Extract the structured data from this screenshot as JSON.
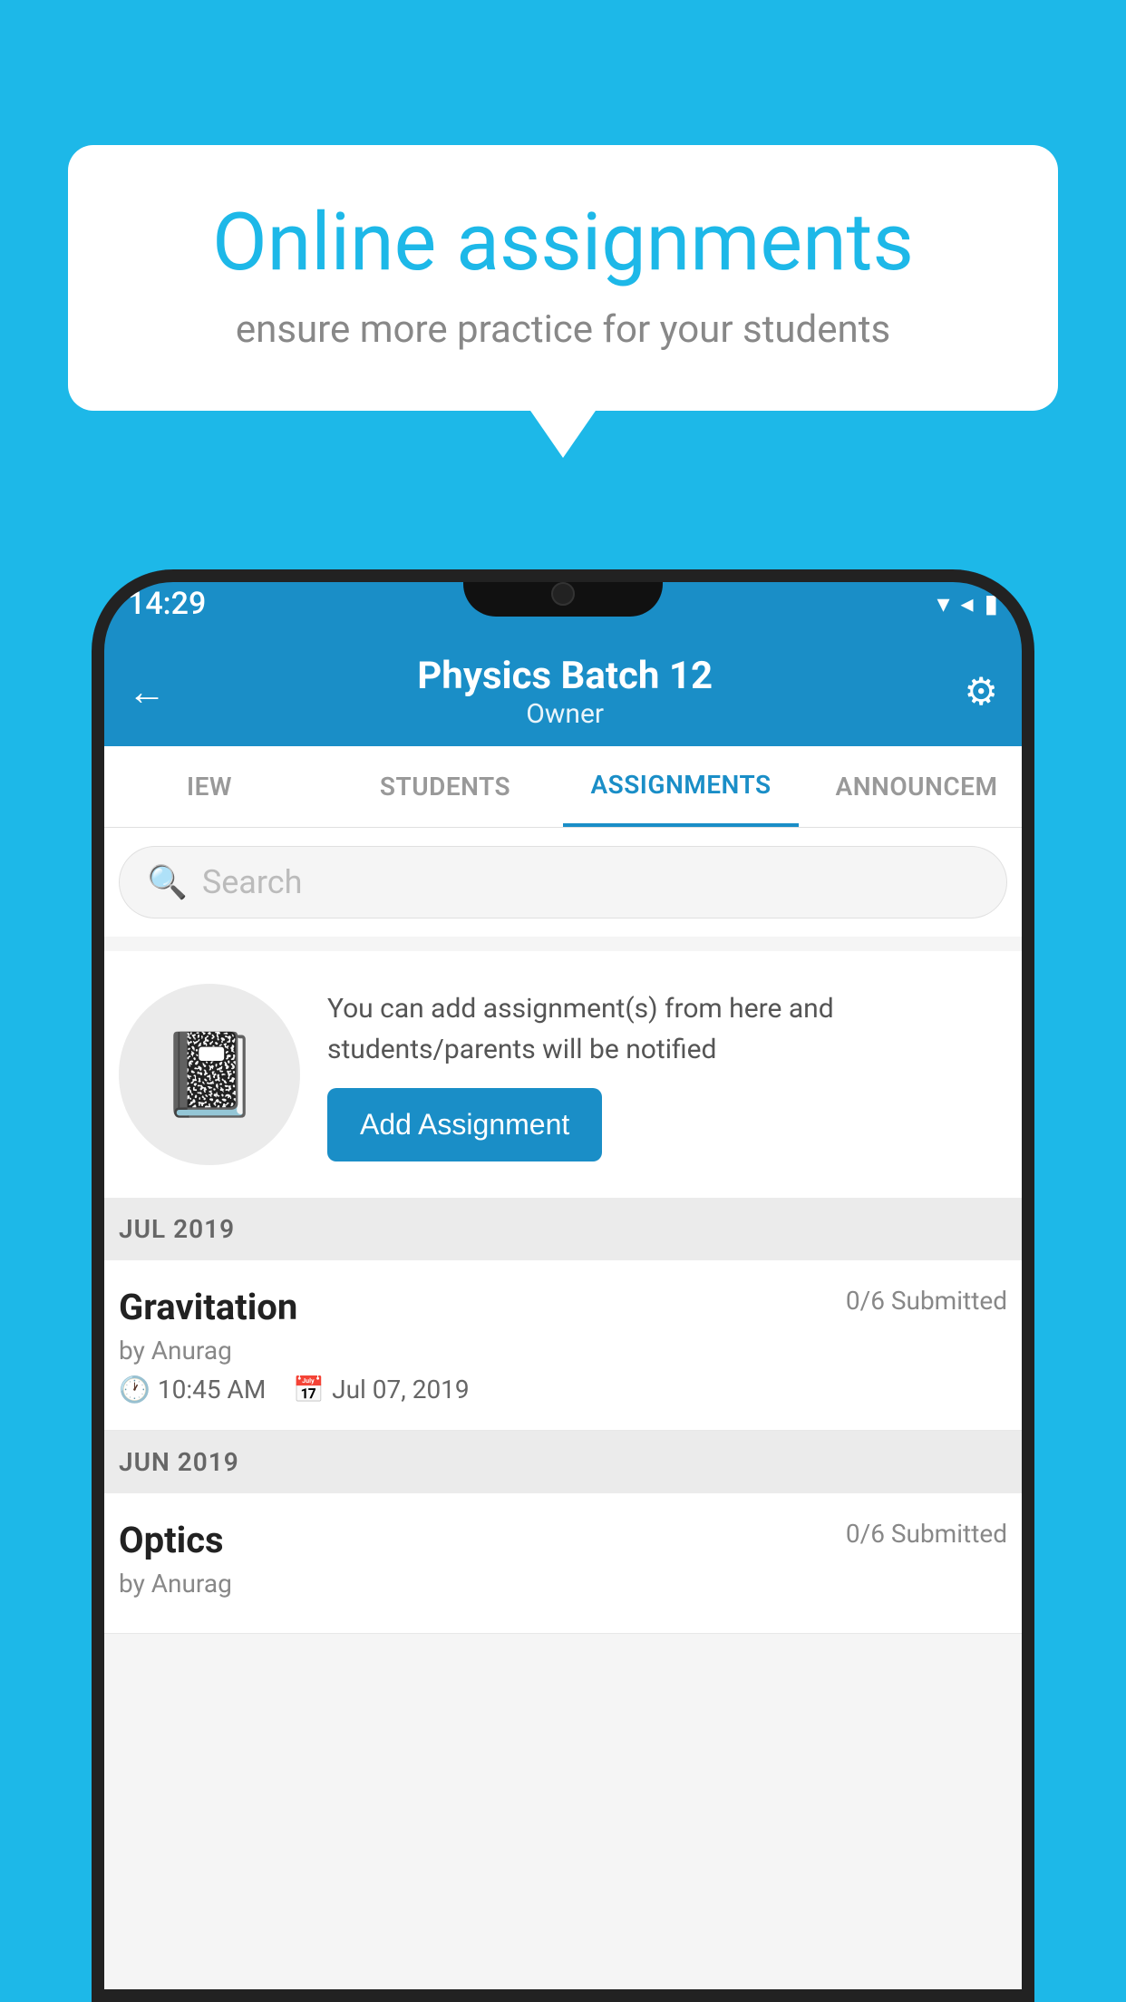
{
  "background_color": "#1DB8E8",
  "bubble": {
    "title": "Online assignments",
    "subtitle": "ensure more practice for your students"
  },
  "status_bar": {
    "time": "14:29",
    "wifi": "▼",
    "signal": "▲",
    "battery": "▮"
  },
  "header": {
    "title": "Physics Batch 12",
    "subtitle": "Owner",
    "back_label": "←",
    "settings_label": "⚙"
  },
  "tabs": [
    {
      "label": "IEW",
      "active": false
    },
    {
      "label": "STUDENTS",
      "active": false
    },
    {
      "label": "ASSIGNMENTS",
      "active": true
    },
    {
      "label": "ANNOUNCEM",
      "active": false
    }
  ],
  "search": {
    "placeholder": "Search"
  },
  "promo": {
    "description": "You can add assignment(s) from here and students/parents will be notified",
    "button_label": "Add Assignment"
  },
  "sections": [
    {
      "month": "JUL 2019",
      "assignments": [
        {
          "title": "Gravitation",
          "status": "0/6 Submitted",
          "by": "by Anurag",
          "time": "10:45 AM",
          "date": "Jul 07, 2019"
        }
      ]
    },
    {
      "month": "JUN 2019",
      "assignments": [
        {
          "title": "Optics",
          "status": "0/6 Submitted",
          "by": "by Anurag",
          "time": "",
          "date": ""
        }
      ]
    }
  ]
}
